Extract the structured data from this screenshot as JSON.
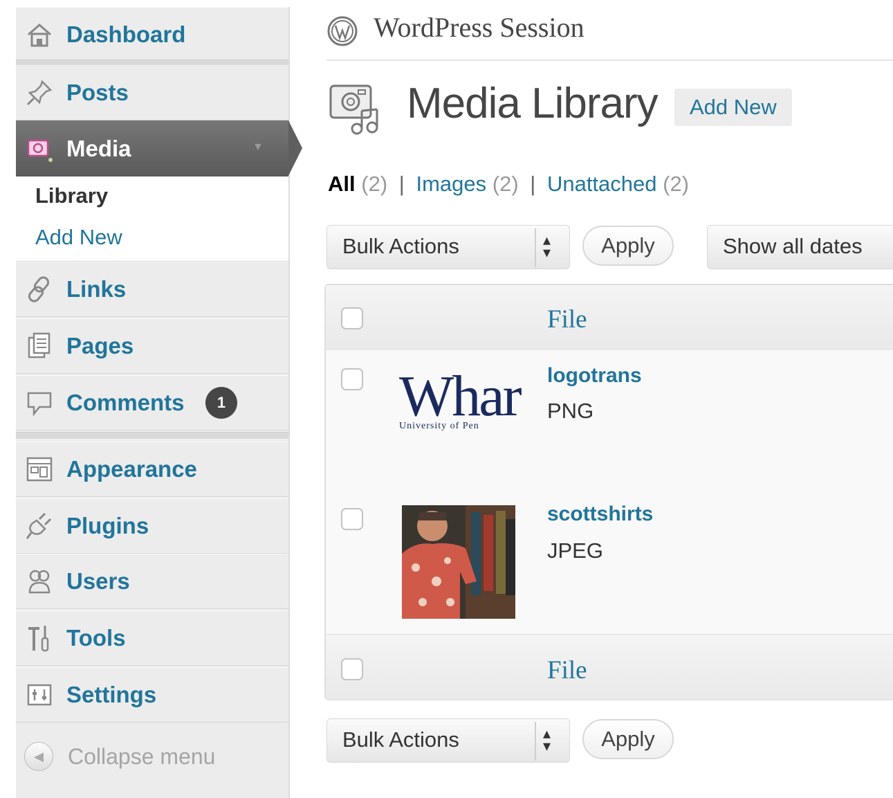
{
  "sidebar": {
    "items": [
      {
        "id": "dashboard",
        "label": "Dashboard"
      },
      {
        "id": "posts",
        "label": "Posts"
      },
      {
        "id": "media",
        "label": "Media"
      },
      {
        "id": "links",
        "label": "Links"
      },
      {
        "id": "pages",
        "label": "Pages"
      },
      {
        "id": "comments",
        "label": "Comments",
        "badge": "1"
      },
      {
        "id": "appearance",
        "label": "Appearance"
      },
      {
        "id": "plugins",
        "label": "Plugins"
      },
      {
        "id": "users",
        "label": "Users"
      },
      {
        "id": "tools",
        "label": "Tools"
      },
      {
        "id": "settings",
        "label": "Settings"
      }
    ],
    "submenu": [
      {
        "label": "Library",
        "current": true
      },
      {
        "label": "Add New",
        "current": false
      }
    ],
    "collapse_label": "Collapse menu"
  },
  "header": {
    "site_title": "WordPress Session"
  },
  "page": {
    "title": "Media Library",
    "add_new_label": "Add New"
  },
  "filters": {
    "all_label": "All",
    "all_count": "(2)",
    "images_label": "Images",
    "images_count": "(2)",
    "unattached_label": "Unattached",
    "unattached_count": "(2)",
    "separator": "|"
  },
  "toolbar": {
    "bulk_actions_label": "Bulk Actions",
    "apply_label": "Apply",
    "date_filter_label": "Show all dates"
  },
  "table": {
    "column_file": "File",
    "rows": [
      {
        "title": "logotrans",
        "type": "PNG",
        "thumb_text": "Whar",
        "thumb_subtext": "University of Pen"
      },
      {
        "title": "scottshirts",
        "type": "JPEG"
      }
    ]
  },
  "colors": {
    "link": "#21759b",
    "menu_bg": "#ececec",
    "menu_active": "#5f5f5f",
    "badge": "#464646"
  }
}
